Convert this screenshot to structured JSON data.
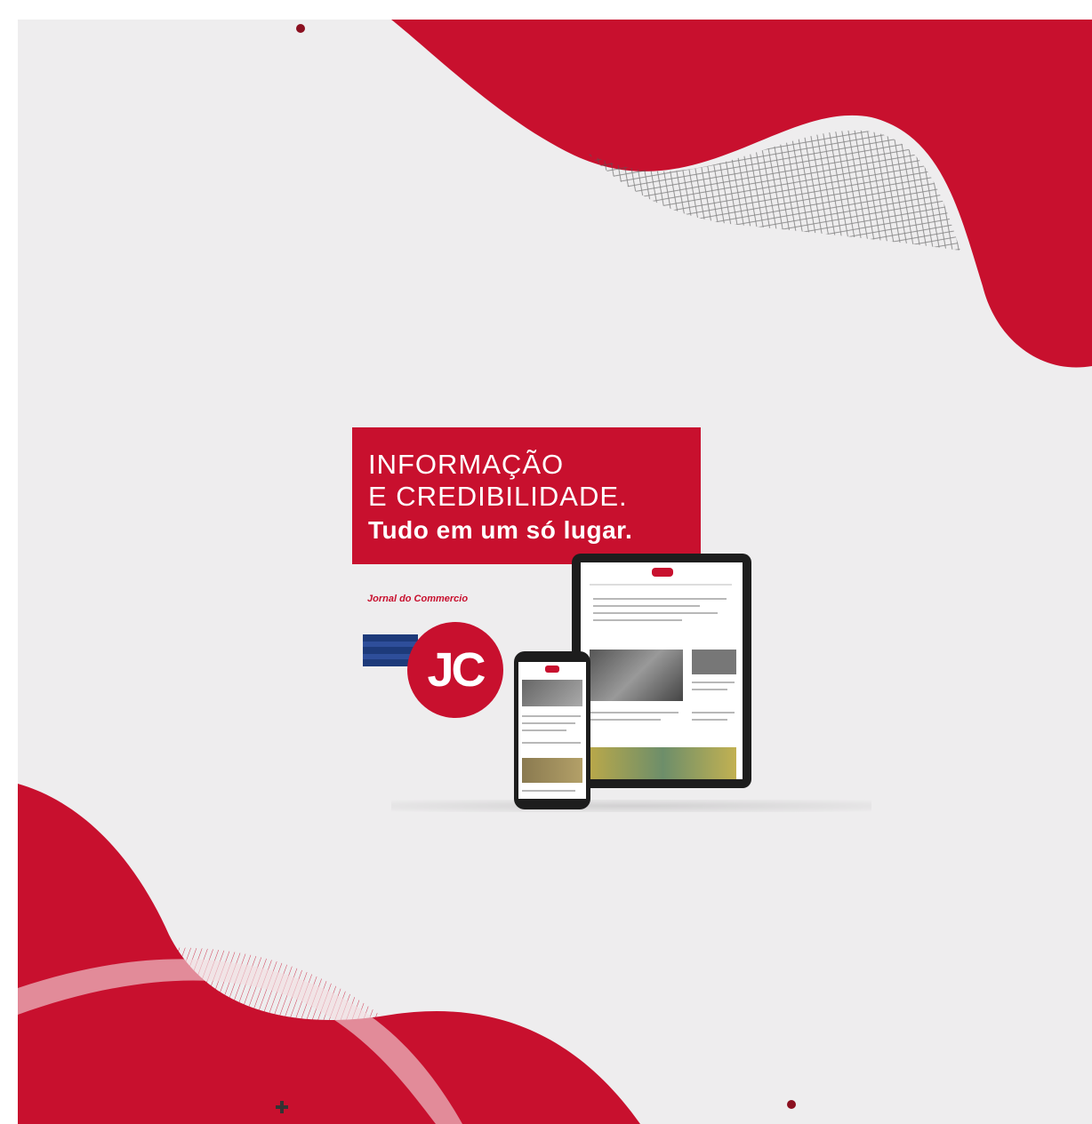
{
  "headline": {
    "line1": "INFORMAÇÃO",
    "line2": "E CREDIBILIDADE.",
    "line3": "Tudo em um só lugar."
  },
  "brand": {
    "name": "Jornal do Commercio",
    "logo_text": "JC"
  },
  "colors": {
    "accent": "#c8102e",
    "background": "#eeedee",
    "device": "#1d1d1d"
  }
}
